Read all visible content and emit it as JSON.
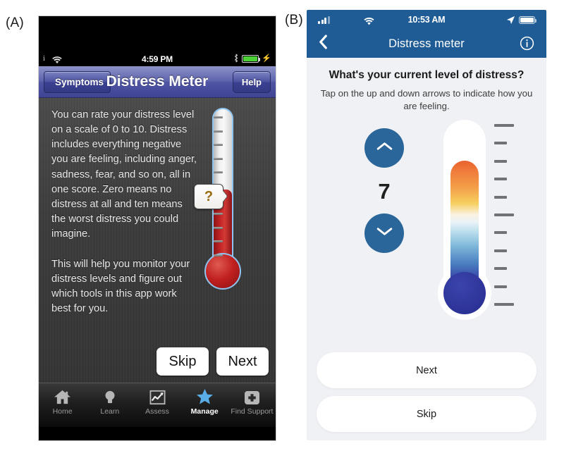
{
  "figure": {
    "panel_a_label": "(A)",
    "panel_b_label": "(B)"
  },
  "panel_a": {
    "status_bar": {
      "carrier_glyph": "i",
      "wifi_icon": "wifi-icon",
      "time": "4:59 PM",
      "bluetooth_icon": "bluetooth-icon",
      "battery_icon": "battery-icon",
      "charging_icon": "charging-bolt-icon"
    },
    "nav": {
      "back_label": "Symptoms",
      "title": "Distress Meter",
      "help_label": "Help"
    },
    "body_text": "You can rate your distress level on a scale of 0 to 10. Distress includes everything negative you are feeling, including anger, sadness, fear, and so on, all in one score. Zero means no distress at all and ten means the worst distress you could imagine.\n\nThis will help you monitor your distress levels and figure out which tools in this app work best for you.",
    "callout": {
      "glyph": "?"
    },
    "actions": {
      "skip_label": "Skip",
      "next_label": "Next"
    },
    "tabbar": {
      "items": [
        {
          "label": "Home",
          "icon": "home-icon",
          "active": false
        },
        {
          "label": "Learn",
          "icon": "lightbulb-icon",
          "active": false
        },
        {
          "label": "Assess",
          "icon": "chart-icon",
          "active": false
        },
        {
          "label": "Manage",
          "icon": "star-icon",
          "active": true
        },
        {
          "label": "Find Support",
          "icon": "plus-icon",
          "active": false
        }
      ]
    },
    "colors": {
      "navbar": "#4f55a3",
      "content_bg": "#3b3b3b",
      "thermometer_fill": "#c62828",
      "thermometer_outline": "#8ec4ef",
      "callout_glyph": "#9a6b11",
      "active_tab": "#5aaee8"
    }
  },
  "panel_b": {
    "status_bar": {
      "signal_icon": "cellular-signal-icon",
      "wifi_icon": "wifi-icon",
      "time": "10:53 AM",
      "location_icon": "location-arrow-icon",
      "battery_icon": "battery-icon"
    },
    "nav": {
      "back_icon": "chevron-left-icon",
      "title": "Distress meter",
      "info_icon": "info-circle-icon"
    },
    "question": "What's your current level of distress?",
    "instruction": "Tap on the up and down arrows to indicate how you are feeling.",
    "stepper": {
      "increase_icon": "chevron-up-icon",
      "decrease_icon": "chevron-down-icon",
      "value": "7"
    },
    "actions": {
      "next_label": "Next",
      "skip_label": "Skip"
    },
    "colors": {
      "header": "#1f5c96",
      "page_bg": "#f0f1f5",
      "stepper_button": "#2a6699",
      "thermometer_top": "#e8622e",
      "thermometer_bottom": "#2e349c",
      "tick": "#6f7378"
    },
    "scale": {
      "min": 0,
      "max": 10,
      "tick_count": 11,
      "major_ticks": [
        0,
        5,
        10
      ]
    }
  }
}
